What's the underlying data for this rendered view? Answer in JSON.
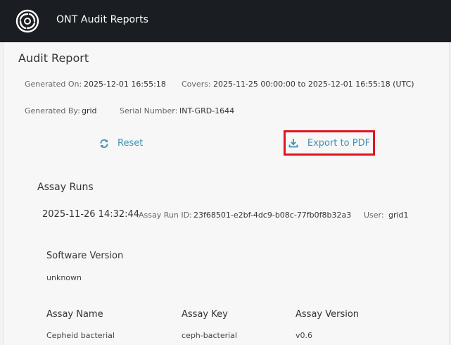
{
  "app": {
    "title": "ONT Audit Reports"
  },
  "report": {
    "title": "Audit Report",
    "generated_on_label": "Generated On:",
    "generated_on_value": "2025-12-01 16:55:18",
    "covers_label": "Covers:",
    "covers_value": "2025-11-25 00:00:00 to 2025-12-01 16:55:18 (UTC)",
    "generated_by_label": "Generated By:",
    "generated_by_value": "grid",
    "serial_label": "Serial Number:",
    "serial_value": "INT-GRD-1644"
  },
  "actions": {
    "reset_label": "Reset",
    "export_label": "Export to PDF",
    "accent_color": "#3b93b3",
    "highlight_color": "#e0141e"
  },
  "assay_runs": {
    "section_title": "Assay Runs",
    "run": {
      "date": "2025-11-26 14:32:44",
      "id_label": "Assay Run ID:",
      "id_value": "23f68501-e2bf-4dc9-b08c-77fb0f8b32a3",
      "user_label": "User:",
      "user_value": "grid1",
      "software_version_label": "Software Version",
      "software_version_value": "unknown",
      "columns": [
        "Assay Name",
        "Assay Key",
        "Assay Version"
      ],
      "row": [
        "Cepheid bacterial",
        "ceph-bacterial",
        "v0.6"
      ]
    }
  }
}
